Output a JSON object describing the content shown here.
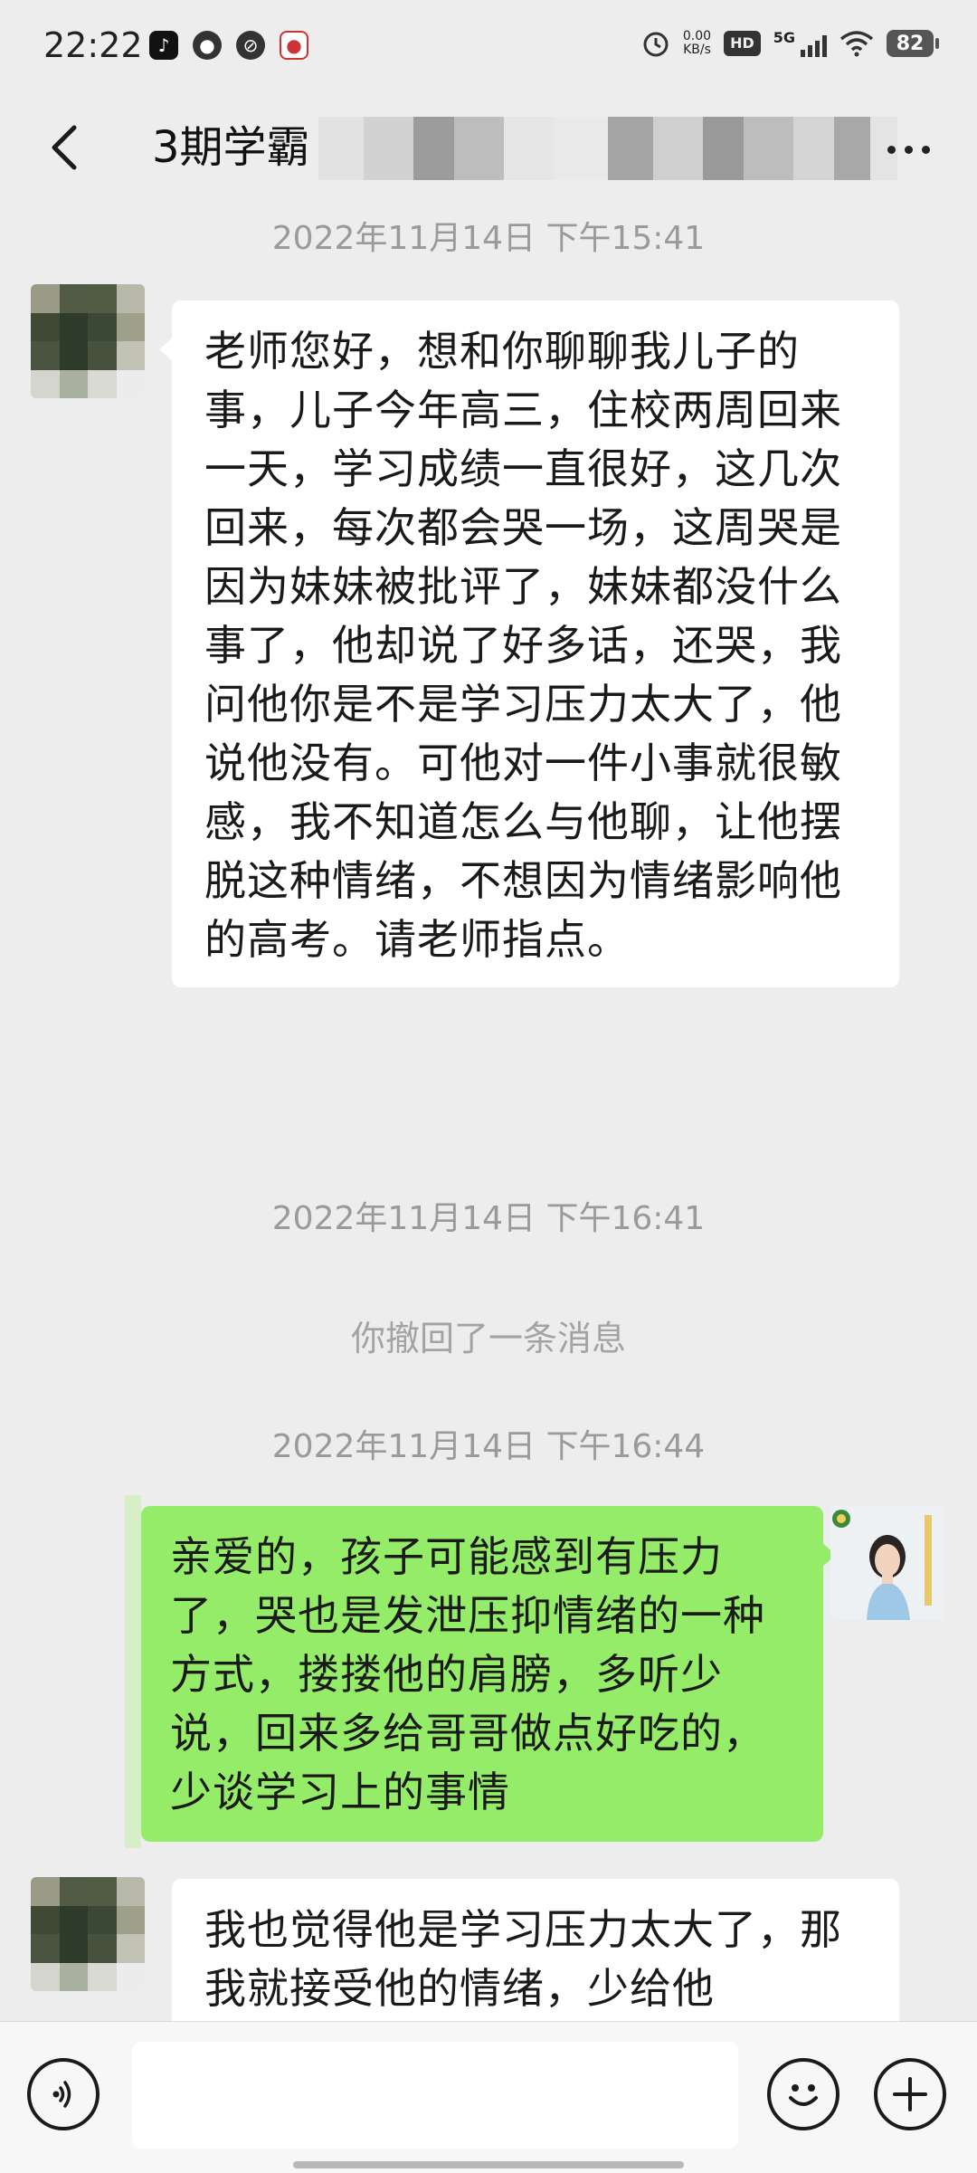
{
  "status_bar": {
    "time": "22:22",
    "app_icons": [
      "tiktok-icon",
      "message-bubble-icon",
      "leaf-icon",
      "map-pin-icon"
    ],
    "net_speed_value": "0.00",
    "net_speed_unit": "KB/s",
    "hd_label": "HD",
    "network_label": "5G",
    "battery_level": "82"
  },
  "header": {
    "title": "3期学霸",
    "back_icon": "chevron-left-icon",
    "more_icon": "more-dots-icon"
  },
  "messages": [
    {
      "type": "timestamp",
      "text": "2022年11月14日 下午15:41"
    },
    {
      "type": "incoming",
      "text": "老师您好，想和你聊聊我儿子的事，儿子今年高三，住校两周回来一天，学习成绩一直很好，这几次回来，每次都会哭一场，这周哭是因为妹妹被批评了，妹妹都没什么事了，他却说了好多话，还哭，我问他你是不是学习压力太大了，他说他没有。可他对一件小事就很敏感，我不知道怎么与他聊，让他摆脱这种情绪，不想因为情绪影响他的高考。请老师指点。"
    },
    {
      "type": "timestamp",
      "text": "2022年11月14日 下午16:41"
    },
    {
      "type": "system",
      "text": "你撤回了一条消息"
    },
    {
      "type": "timestamp",
      "text": "2022年11月14日 下午16:44"
    },
    {
      "type": "outgoing",
      "text": "亲爱的，孩子可能感到有压力了，哭也是发泄压抑情绪的一种方式，搂搂他的肩膀，多听少说，回来多给哥哥做点好吃的，少谈学习上的事情"
    },
    {
      "type": "incoming",
      "text": "我也觉得他是学习压力太大了，那我就接受他的情绪，少给他"
    }
  ],
  "input_bar": {
    "voice_icon": "voice-icon",
    "emoji_icon": "emoji-icon",
    "plus_icon": "plus-icon",
    "text_value": ""
  },
  "colors": {
    "background": "#ededed",
    "outgoing_bubble": "#95ec69",
    "incoming_bubble": "#ffffff",
    "timestamp_text": "#9a9a9a"
  }
}
